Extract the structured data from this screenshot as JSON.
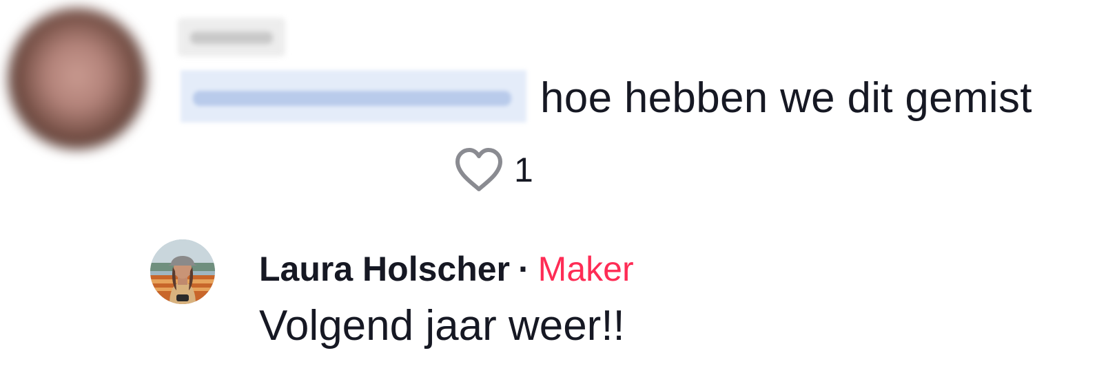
{
  "comment": {
    "avatar_icon": "blurred-user-avatar",
    "text": "hoe hebben we dit gemist",
    "like_icon": "heart-outline-icon",
    "like_count": "1"
  },
  "reply": {
    "author": "Laura Holscher",
    "separator": "·",
    "badge": "Maker",
    "badge_color": "#fe2c55",
    "text": "Volgend jaar weer!!"
  }
}
